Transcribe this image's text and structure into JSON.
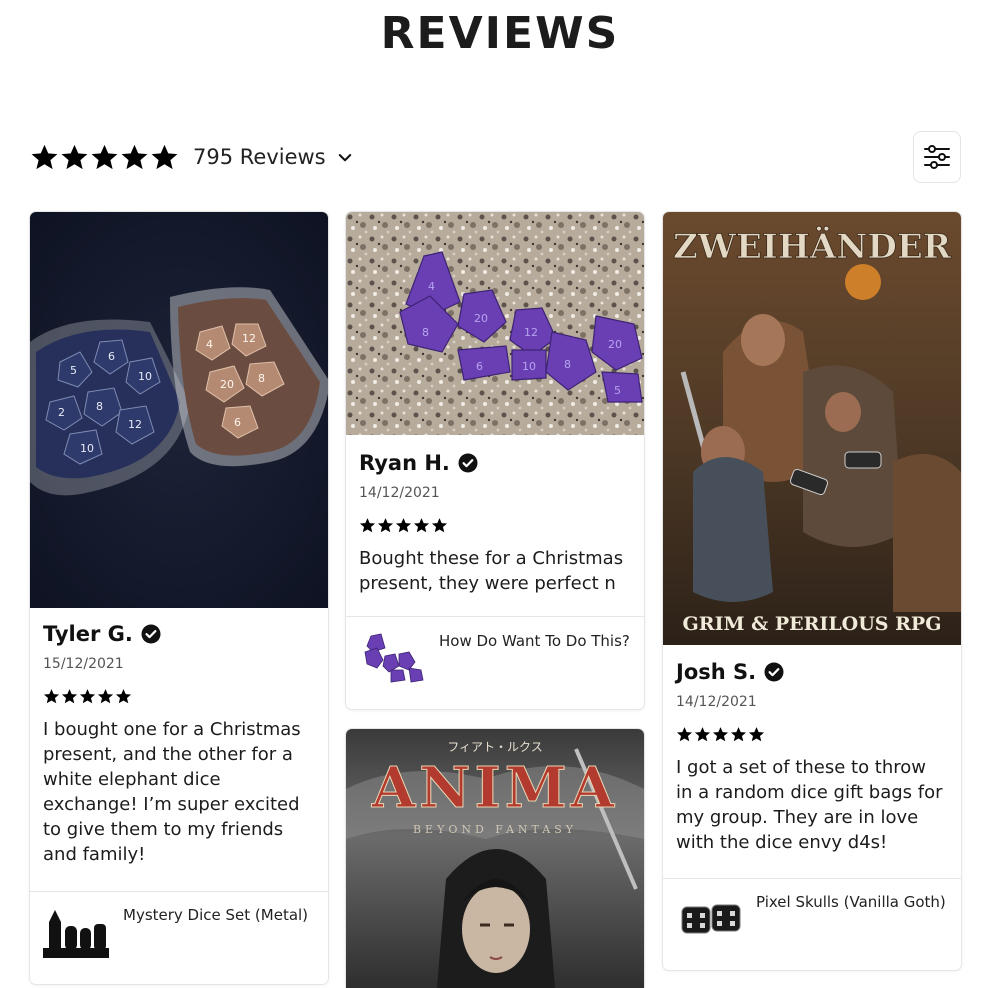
{
  "header": {
    "title": "REVIEWS"
  },
  "summary": {
    "rating_stars": 5,
    "count_label": "795 Reviews"
  },
  "filter": {
    "icon": "sliders-icon"
  },
  "reviews": [
    {
      "photo": "dice bags on dark fabric",
      "reviewer": "Tyler G.",
      "date": "15/12/2021",
      "rating": 5,
      "text": "I bought one for a Christmas present, and the other for a white elephant dice exchange! I’m super excited to give them to my friends and family!",
      "product": "Mystery Dice Set (Metal)"
    },
    {
      "photo": "purple dice on granite",
      "reviewer": "Ryan H.",
      "date": "14/12/2021",
      "rating": 5,
      "text": "Bought these for a Christmas present, they were perfect n",
      "product": "How Do Want To Do This?"
    },
    {
      "photo": "ZWEIHÄNDER rulebook cover",
      "photo_caption_top": "ZWEIHÄNDER",
      "photo_caption_bottom": "GRIM & PERILOUS RPG",
      "reviewer": "Josh S.",
      "date": "14/12/2021",
      "rating": 5,
      "text": "I got a set of these to throw in a random dice gift bags for my group.  They are in love with the dice envy d4s!",
      "product": "Pixel Skulls (Vanilla Goth)"
    },
    {
      "photo": "Anima Beyond Fantasy book cover",
      "photo_caption_kana": "フィアト・ルクス",
      "photo_caption_title": "ANIMA",
      "photo_caption_sub": "BEYOND FANTASY"
    }
  ],
  "colors": {
    "star": "#000000",
    "text": "#1c1c1c",
    "border": "#e6e6e6"
  }
}
